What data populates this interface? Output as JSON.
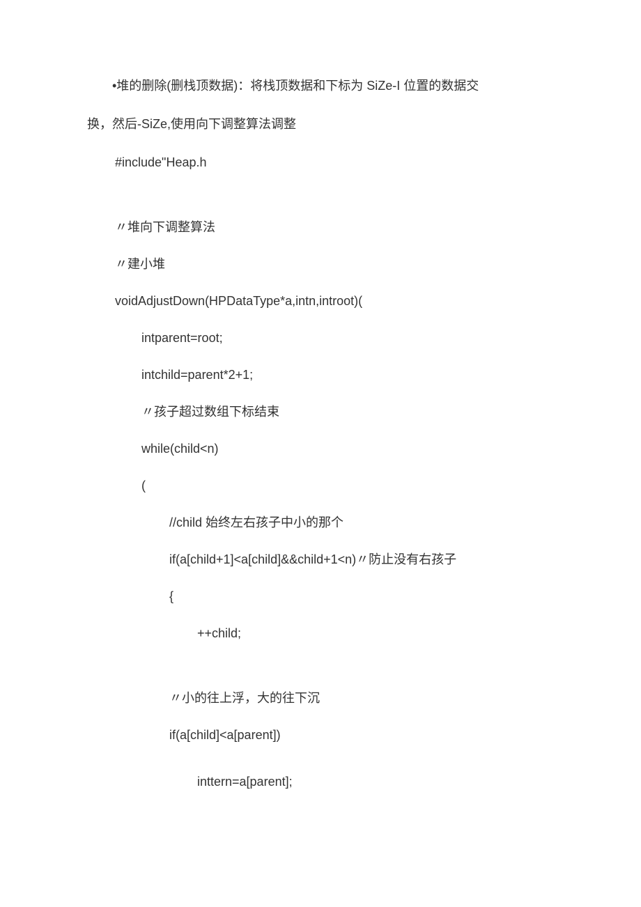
{
  "document": {
    "intro_part1": "•堆的删除(删栈顶数据)：将栈顶数据和下标为 SiZe-I 位置的数据交",
    "intro_part2": "换，然后-SiZe,使用向下调整算法调整",
    "lines": [
      {
        "text": "#include\"Heap.h",
        "indent": 1
      },
      {
        "spacer": true
      },
      {
        "text": "〃堆向下调整算法",
        "indent": 1
      },
      {
        "text": "〃建小堆",
        "indent": 1
      },
      {
        "text": "voidAdjustDown(HPDataType*a,intn,introot)(",
        "indent": 1
      },
      {
        "text": "intparent=root;",
        "indent": 2
      },
      {
        "text": "intchild=parent*2+1;",
        "indent": 2
      },
      {
        "text": "〃孩子超过数组下标结束",
        "indent": 2
      },
      {
        "text": "while(child<n)",
        "indent": 2
      },
      {
        "text": "(",
        "indent": 2
      },
      {
        "text": "//child 始终左右孩子中小的那个",
        "indent": 3
      },
      {
        "text": "if(a[child+1]<a[child]&&child+1<n)〃防止没有右孩子",
        "indent": 3
      },
      {
        "text": "{",
        "indent": 3
      },
      {
        "text": "++child;",
        "indent": 4
      },
      {
        "spacer": true
      },
      {
        "text": "〃小的往上浮，大的往下沉",
        "indent": 3
      },
      {
        "text": "if(a[child]<a[parent])",
        "indent": 3
      },
      {
        "spacer_sm": true
      },
      {
        "text": "inttern=a[parent];",
        "indent": 4
      }
    ]
  }
}
